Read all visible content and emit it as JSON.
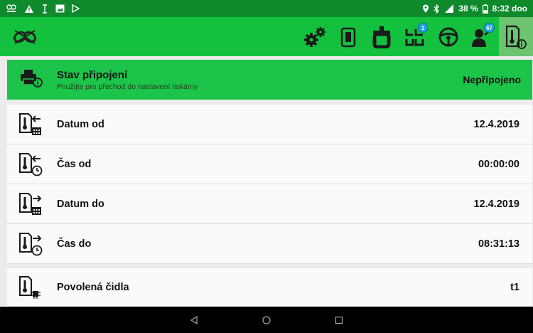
{
  "status_bar": {
    "battery": "38 %",
    "time": "8:32 doo"
  },
  "toolbar": {
    "notifications_badge": "1",
    "user_badge": "67"
  },
  "connection": {
    "title": "Stav připojení",
    "subtitle": "Použijte pro přechod do nastavení tiskárny",
    "value": "Nepřipojeno"
  },
  "rows": [
    {
      "label": "Datum od",
      "value": "12.4.2019",
      "icon": "thermo-calendar-in-icon"
    },
    {
      "label": "Čas od",
      "value": "00:00:00",
      "icon": "thermo-clock-in-icon"
    },
    {
      "label": "Datum do",
      "value": "12.4.2019",
      "icon": "thermo-calendar-out-icon"
    },
    {
      "label": "Čas do",
      "value": "08:31:13",
      "icon": "thermo-clock-out-icon"
    }
  ],
  "sensors": {
    "label": "Povolená čidla",
    "value": "t1"
  },
  "colors": {
    "status_bar": "#0e8a2c",
    "toolbar": "#13c13f",
    "connection_row": "#1cc44a",
    "active_tab": "#6cc46e",
    "badge": "#1fa2e0"
  }
}
